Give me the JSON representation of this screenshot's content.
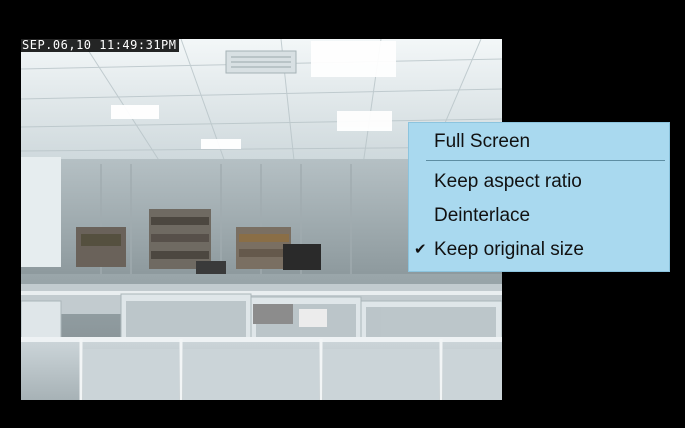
{
  "overlay": {
    "timestamp": "SEP.06,10 11:49:31PM"
  },
  "context_menu": {
    "items": [
      {
        "label": "Full Screen",
        "checked": false
      },
      {
        "label": "Keep aspect ratio",
        "checked": false
      },
      {
        "label": "Deinterlace",
        "checked": false
      },
      {
        "label": "Keep original size",
        "checked": true
      }
    ],
    "check_glyph": "✔"
  },
  "colors": {
    "background": "#000000",
    "menu_background": "#a9d9ef"
  }
}
